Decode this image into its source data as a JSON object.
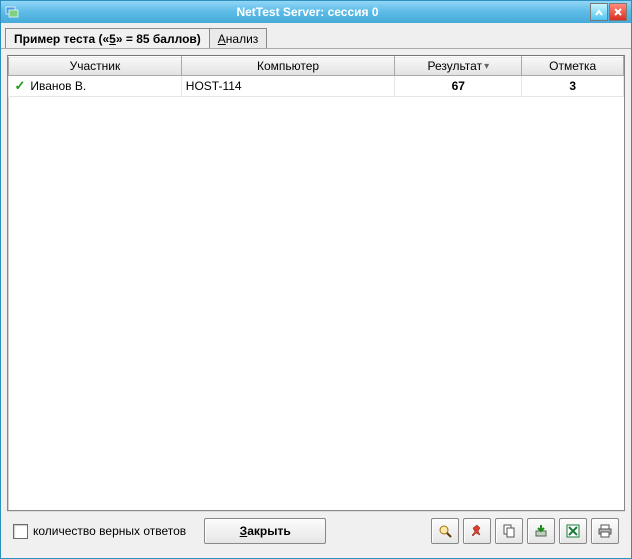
{
  "window": {
    "title": "NetTest Server: сессия 0"
  },
  "tabs": {
    "main_prefix": "Пример теста («",
    "main_mid": "5",
    "main_suffix": "» = 85 баллов)",
    "analysis_u": "А",
    "analysis_rest": "нализ"
  },
  "table": {
    "headers": {
      "participant": "Участник",
      "computer": "Компьютер",
      "result": "Результат",
      "mark": "Отметка"
    },
    "rows": [
      {
        "participant": "Иванов В.",
        "computer": "HOST-114",
        "result": "67",
        "mark": "3"
      }
    ]
  },
  "footer": {
    "checkbox_label": "количество верных ответов",
    "close_u": "З",
    "close_rest": "акрыть"
  },
  "colwidths": {
    "c1": "170",
    "c2": "210",
    "c3": "125",
    "c4": "100"
  }
}
